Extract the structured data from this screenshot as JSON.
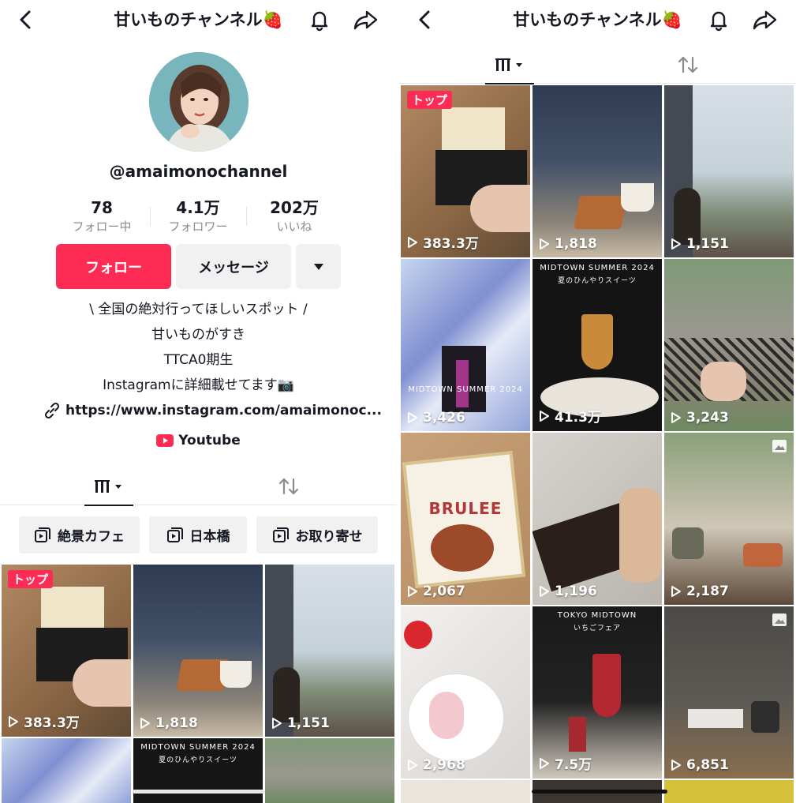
{
  "app": {
    "title": "甘いものチャンネル🍓",
    "icons": {
      "back": "chevron-left-icon",
      "bell": "bell-icon",
      "share": "share-icon"
    }
  },
  "profile": {
    "username": "@amaimonochannel",
    "stats": [
      {
        "value": "78",
        "label": "フォロー中"
      },
      {
        "value": "4.1万",
        "label": "フォロワー"
      },
      {
        "value": "202万",
        "label": "いいね"
      }
    ],
    "buttons": {
      "follow": "フォロー",
      "message": "メッセージ"
    },
    "bio": [
      "\\ 全国の絶対行ってほしいスポット /",
      "甘いものがすき",
      "TTCA0期生",
      "Instagramに詳細載せてます📷"
    ],
    "link": "https://www.instagram.com/amaimonoc...",
    "youtube": "Youtube"
  },
  "playlists": [
    {
      "label": "絶景カフェ"
    },
    {
      "label": "日本橋"
    },
    {
      "label": "お取り寄せ"
    }
  ],
  "left_videos": [
    {
      "count": "383.3万",
      "badge": "トップ"
    },
    {
      "count": "1,818"
    },
    {
      "count": "1,151"
    }
  ],
  "left_overlay_texts": {
    "midtown": "MIDTOWN SUMMER 2024",
    "midtown_sub": "夏のひんやりスイーツ"
  },
  "right_videos": [
    {
      "count": "383.3万",
      "badge": "トップ"
    },
    {
      "count": "1,818"
    },
    {
      "count": "1,151"
    },
    {
      "count": "3,426"
    },
    {
      "count": "41.3万"
    },
    {
      "count": "3,243"
    },
    {
      "count": "2,067"
    },
    {
      "count": "1,196"
    },
    {
      "count": "2,187"
    },
    {
      "count": "2,968"
    },
    {
      "count": "7.5万"
    },
    {
      "count": "6,851"
    }
  ],
  "right_overlay_texts": {
    "midtown": "MIDTOWN SUMMER 2024",
    "midtown_sub": "夏のひんやりスイーツ",
    "brulee": "BRULEE",
    "tokyo_midtown": "TOKYO MIDTOWN",
    "strawberry": "いちごフェア"
  },
  "colors": {
    "accent": "#fe2c55",
    "text": "#161823",
    "muted": "#8a8b91",
    "chip_bg": "#f1f1f2"
  }
}
